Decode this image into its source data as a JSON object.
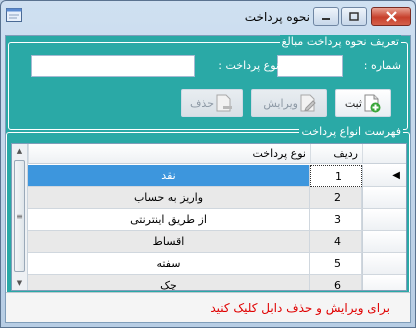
{
  "window": {
    "title": "نحوه پرداخت",
    "min_glyph": "—",
    "max_glyph": "□",
    "close_glyph": "✕"
  },
  "definition": {
    "legend": "تعریف نحوه پرداخت مبالغ",
    "number_label": "شماره :",
    "number_value": "",
    "type_label": "نوع پرداخت :",
    "type_value": ""
  },
  "buttons": {
    "save": "ثبت",
    "edit": "ویرایش",
    "delete": "حذف"
  },
  "list": {
    "legend": "فهرست انواع پرداخت",
    "columns": {
      "row": "ردیف",
      "type": "نوع پرداخت"
    },
    "rows": [
      {
        "num": "1",
        "name": "نقد",
        "selected": true
      },
      {
        "num": "2",
        "name": "واریز به حساب",
        "selected": false
      },
      {
        "num": "3",
        "name": "از طریق اینترنتی",
        "selected": false
      },
      {
        "num": "4",
        "name": "اقساط",
        "selected": false
      },
      {
        "num": "5",
        "name": "سفته",
        "selected": false
      },
      {
        "num": "6",
        "name": "چک",
        "selected": false
      }
    ]
  },
  "status": {
    "message": "برای ویرایش و حذف دابل کلیک کنید"
  },
  "colors": {
    "panel": "#2aa9a6",
    "selected_row": "#3d96dd",
    "alt_row": "#e9e9e9",
    "status_text": "#e00000"
  }
}
